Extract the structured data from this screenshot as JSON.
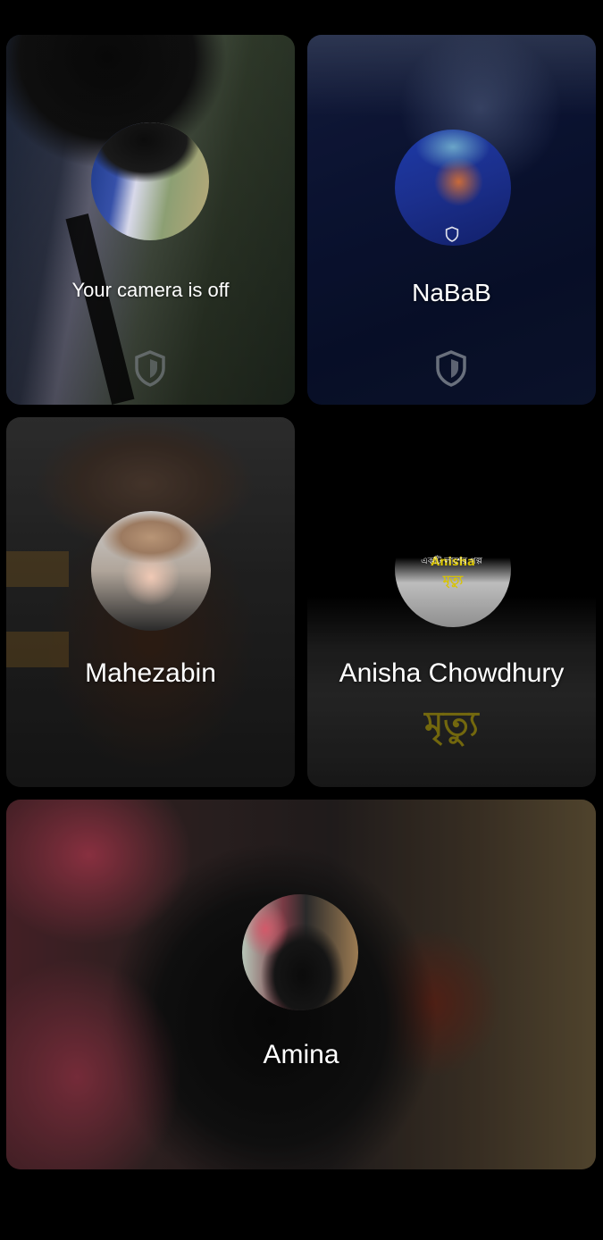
{
  "participants": [
    {
      "name": "Your camera is off",
      "has_shield": true
    },
    {
      "name": "NaBaB",
      "has_shield": true
    },
    {
      "name": "Mahezabin",
      "has_shield": false
    },
    {
      "name": "Anisha Chowdhury",
      "has_shield": false,
      "background_text": {
        "title_bn": "একটি লাশের গল্প",
        "name": "Anisha",
        "word_bn": "মৃত্যু"
      }
    },
    {
      "name": "Amina",
      "has_shield": false
    }
  ],
  "colors": {
    "background": "#000000",
    "name_text": "#ffffff",
    "shield": "#8a9099",
    "caption_yellow": "#d9c400"
  },
  "icons": {
    "shield": "shield-icon"
  }
}
